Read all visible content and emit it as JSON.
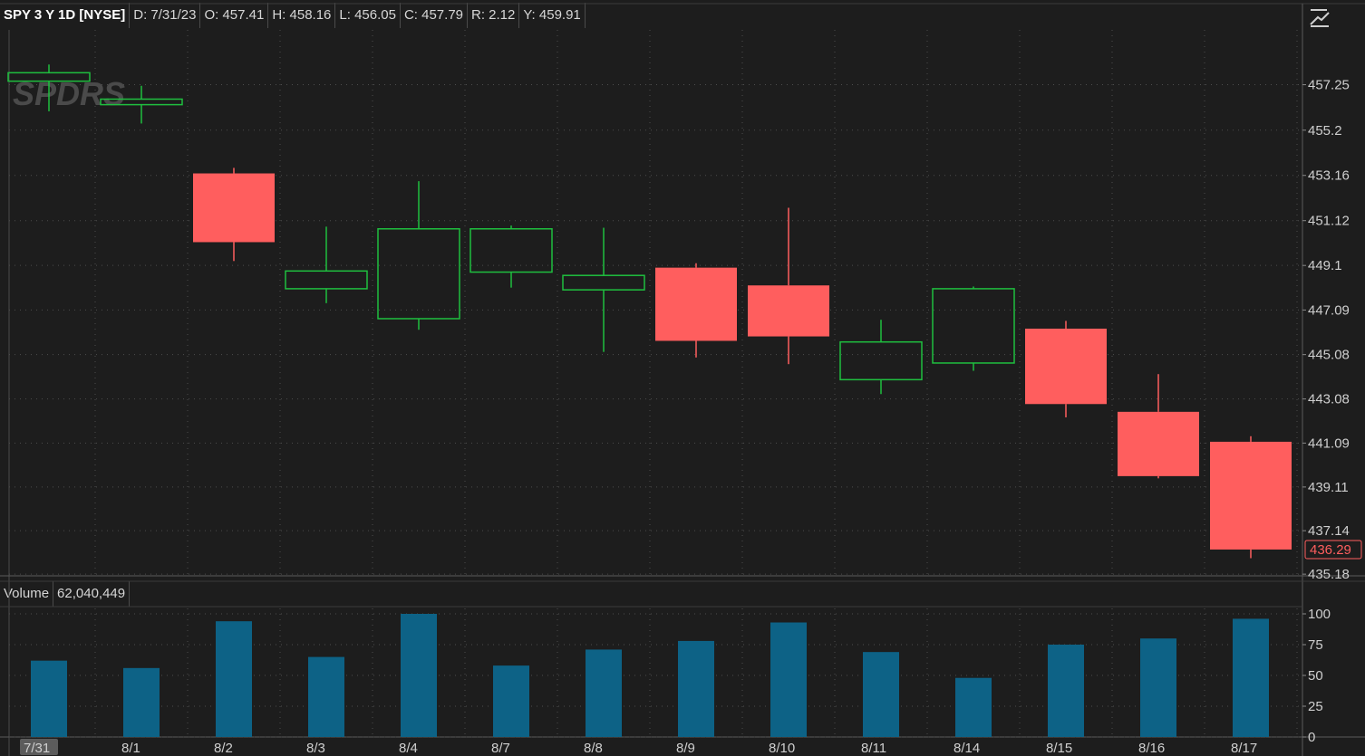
{
  "header": {
    "symbol": "SPY 3 Y 1D [NYSE]",
    "date": "D: 7/31/23",
    "open": "O: 457.41",
    "high": "H: 458.16",
    "low": "L: 456.05",
    "close": "C: 457.79",
    "range": "R: 2.12",
    "y": "Y: 459.91"
  },
  "volume_header": {
    "label": "Volume",
    "value": "62,040,449"
  },
  "watermark": "SPDRS",
  "colors": {
    "up": "#1fbf3f",
    "down": "#ff5e5e",
    "volume": "#0d6286",
    "background": "#1d1d1d",
    "grid": "#4d4d4d",
    "last_price_tag": "#ff5e5e"
  },
  "icons": {
    "chart_style": "chart-style-icon"
  },
  "chart_data": [
    {
      "type": "candlestick",
      "x": [
        "7/31",
        "8/1",
        "8/2",
        "8/3",
        "8/4",
        "8/7",
        "8/8",
        "8/9",
        "8/10",
        "8/11",
        "8/14",
        "8/15",
        "8/16",
        "8/17"
      ],
      "x_tick_labels": [
        "7/31",
        "8/1",
        "8/2",
        "8/3",
        "8/4",
        "8/7",
        "8/8",
        "8/9",
        "8/10",
        "8/11",
        "8/14",
        "8/15",
        "8/16",
        "8/17"
      ],
      "highlighted_x": "7/31",
      "open": [
        457.41,
        456.35,
        453.25,
        448.05,
        446.7,
        448.8,
        448.0,
        449.0,
        448.2,
        443.95,
        444.7,
        446.25,
        442.5,
        441.15
      ],
      "high": [
        458.16,
        457.2,
        453.5,
        450.85,
        452.9,
        450.9,
        450.8,
        449.2,
        451.7,
        446.65,
        448.15,
        446.6,
        444.2,
        441.4
      ],
      "low": [
        456.05,
        455.5,
        449.3,
        447.4,
        446.2,
        448.1,
        445.2,
        444.95,
        444.65,
        443.3,
        444.35,
        442.25,
        439.5,
        435.9
      ],
      "close": [
        457.79,
        456.6,
        450.15,
        448.85,
        450.75,
        450.75,
        448.65,
        445.7,
        445.9,
        445.65,
        448.05,
        442.85,
        439.6,
        436.29
      ],
      "y_ticks": [
        "457.25",
        "455.2",
        "453.16",
        "451.12",
        "449.1",
        "447.09",
        "445.08",
        "443.08",
        "441.09",
        "439.11",
        "437.14",
        "435.18"
      ],
      "ylim": [
        434.9,
        459.6
      ],
      "last_price": "436.29",
      "grid": true
    },
    {
      "type": "bar",
      "x": [
        "7/31",
        "8/1",
        "8/2",
        "8/3",
        "8/4",
        "8/7",
        "8/8",
        "8/9",
        "8/10",
        "8/11",
        "8/14",
        "8/15",
        "8/16",
        "8/17"
      ],
      "values": [
        62,
        56,
        94,
        65,
        100,
        58,
        71,
        78,
        93,
        69,
        48,
        75,
        80,
        96
      ],
      "y_ticks": [
        "100",
        "75",
        "50",
        "25",
        "0"
      ],
      "ylim": [
        0,
        100
      ],
      "grid": true
    }
  ]
}
